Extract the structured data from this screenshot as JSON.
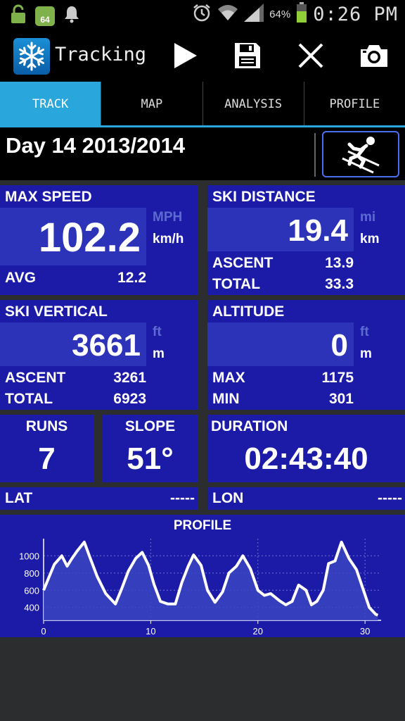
{
  "status_bar": {
    "battery_pct": "64%",
    "time": "0:26 PM",
    "badge": "64"
  },
  "app": {
    "title": "Tracking"
  },
  "tabs": [
    {
      "label": "TRACK",
      "active": true
    },
    {
      "label": "MAP",
      "active": false
    },
    {
      "label": "ANALYSIS",
      "active": false
    },
    {
      "label": "PROFILE",
      "active": false
    }
  ],
  "header": {
    "title": "Day 14 2013/2014",
    "activity_icon": "skier-icon"
  },
  "max_speed": {
    "label": "MAX SPEED",
    "value": "102.2",
    "unit_alt": "MPH",
    "unit": "km/h",
    "avg_label": "AVG",
    "avg_value": "12.2"
  },
  "ski_distance": {
    "label": "SKI DISTANCE",
    "value": "19.4",
    "unit_alt": "mi",
    "unit": "km",
    "ascent_label": "ASCENT",
    "ascent_value": "13.9",
    "total_label": "TOTAL",
    "total_value": "33.3"
  },
  "ski_vertical": {
    "label": "SKI VERTICAL",
    "value": "3661",
    "unit_alt": "ft",
    "unit": "m",
    "ascent_label": "ASCENT",
    "ascent_value": "3261",
    "total_label": "TOTAL",
    "total_value": "6923"
  },
  "altitude": {
    "label": "ALTITUDE",
    "value": "0",
    "unit_alt": "ft",
    "unit": "m",
    "max_label": "MAX",
    "max_value": "1175",
    "min_label": "MIN",
    "min_value": "301"
  },
  "runs": {
    "label": "RUNS",
    "value": "7"
  },
  "slope": {
    "label": "SLOPE",
    "value": "51°"
  },
  "duration": {
    "label": "DURATION",
    "value": "02:43:40"
  },
  "lat": {
    "label": "LAT",
    "value": "-----"
  },
  "lon": {
    "label": "LON",
    "value": "-----"
  },
  "colors": {
    "panel": "#1c1ba8",
    "tab_active": "#29a6dc",
    "line": "#ffffff"
  },
  "chart_data": {
    "type": "area",
    "title": "PROFILE",
    "xlim": [
      0,
      31.5
    ],
    "ylim": [
      250,
      1200
    ],
    "xticks": [
      "0",
      "10",
      "20",
      "30"
    ],
    "yticks": [
      "1000",
      "800",
      "600",
      "400"
    ],
    "x": [
      0,
      0.5,
      1,
      1.7,
      2.2,
      2.6,
      3.1,
      3.8,
      4.3,
      5,
      5.8,
      6.7,
      7.3,
      7.9,
      8.6,
      9.2,
      9.8,
      10.3,
      10.9,
      11.6,
      12.3,
      12.9,
      13.5,
      14,
      14.7,
      15.3,
      16,
      16.7,
      17.3,
      18,
      18.6,
      19.3,
      20,
      20.6,
      21.2,
      22,
      22.6,
      23.2,
      23.8,
      24.5,
      25,
      25.5,
      26.1,
      26.6,
      27.2,
      27.8,
      28.5,
      29.2,
      29.8,
      30.4,
      31,
      31.2
    ],
    "y": [
      600,
      750,
      900,
      1000,
      880,
      960,
      1050,
      1160,
      990,
      760,
      560,
      440,
      620,
      820,
      970,
      1040,
      890,
      670,
      470,
      440,
      440,
      690,
      880,
      1010,
      890,
      600,
      460,
      580,
      800,
      880,
      1000,
      850,
      600,
      540,
      560,
      480,
      430,
      470,
      660,
      600,
      430,
      470,
      600,
      910,
      940,
      1160,
      970,
      840,
      620,
      400,
      320,
      310
    ]
  }
}
